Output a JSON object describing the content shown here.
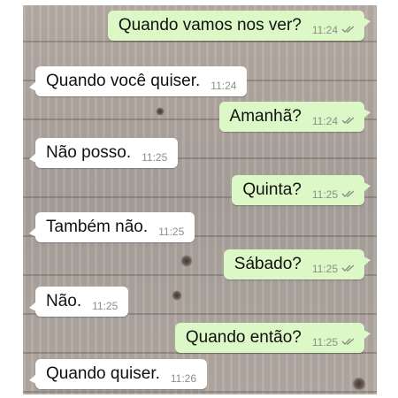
{
  "conversation": {
    "messages": [
      {
        "direction": "outgoing",
        "text": "Quando vamos nos ver?",
        "time": "11:24",
        "status_icon": "double-check-icon"
      },
      {
        "direction": "incoming",
        "text": "Quando você quiser.",
        "time": "11:24"
      },
      {
        "direction": "outgoing",
        "text": "Amanhã?",
        "time": "11:24",
        "status_icon": "double-check-icon"
      },
      {
        "direction": "incoming",
        "text": "Não posso.",
        "time": "11:25"
      },
      {
        "direction": "outgoing",
        "text": "Quinta?",
        "time": "11:25",
        "status_icon": "double-check-icon"
      },
      {
        "direction": "incoming",
        "text": "Também não.",
        "time": "11:25"
      },
      {
        "direction": "outgoing",
        "text": "Sábado?",
        "time": "11:25",
        "status_icon": "double-check-icon"
      },
      {
        "direction": "incoming",
        "text": "Não.",
        "time": "11:25"
      },
      {
        "direction": "outgoing",
        "text": "Quando então?",
        "time": "11:25",
        "status_icon": "double-check-icon"
      },
      {
        "direction": "incoming",
        "text": "Quando quiser.",
        "time": "11:26"
      }
    ]
  },
  "colors": {
    "outgoing_bubble": "#dcf8c6",
    "incoming_bubble": "#ffffff",
    "timestamp": "#8a8f86",
    "tick": "#8a8f86",
    "background": "#aea59e"
  }
}
